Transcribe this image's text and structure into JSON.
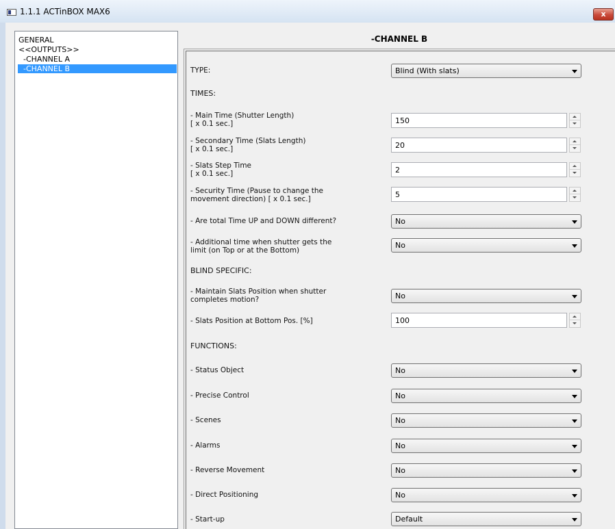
{
  "window": {
    "title": "1.1.1 ACTinBOX MAX6",
    "close_label": "x"
  },
  "tree": {
    "items": [
      "GENERAL",
      "<<OUTPUTS>>",
      "-CHANNEL A",
      "-CHANNEL B"
    ],
    "selected": "-CHANNEL B"
  },
  "page": {
    "heading": "-CHANNEL B"
  },
  "type": {
    "label": "TYPE:",
    "value": "Blind (With slats)"
  },
  "times": {
    "heading": "TIMES:",
    "main_time": {
      "label_line1": "- Main Time (Shutter Length)",
      "label_line2": "  [ x 0.1 sec.]",
      "value": "150"
    },
    "secondary_time": {
      "label_line1": "- Secondary Time (Slats Length)",
      "label_line2": "  [ x 0.1 sec.]",
      "value": "20"
    },
    "slats_step_time": {
      "label_line1": "- Slats Step Time",
      "label_line2": "  [ x 0.1 sec.]",
      "value": "2"
    },
    "security_time": {
      "label_line1": "- Security Time (Pause to change the",
      "label_line2": "  movement direction) [ x 0.1 sec.]",
      "value": "5"
    },
    "total_time_different": {
      "label": "- Are total Time UP and DOWN different?",
      "value": "No"
    },
    "additional_time": {
      "label_line1": "- Additional time when shutter gets the",
      "label_line2": "  limit (on Top or at the Bottom)",
      "value": "No"
    }
  },
  "blind_specific": {
    "heading": "BLIND SPECIFIC:",
    "maintain_slats": {
      "label_line1": "- Maintain Slats Position when shutter",
      "label_line2": "  completes motion?",
      "value": "No"
    },
    "slats_bottom": {
      "label": "- Slats Position at Bottom Pos. [%]",
      "value": "100"
    }
  },
  "functions": {
    "heading": "FUNCTIONS:",
    "items": [
      {
        "label": "- Status Object",
        "value": "No"
      },
      {
        "label": "- Precise Control",
        "value": "No"
      },
      {
        "label": "- Scenes",
        "value": "No"
      },
      {
        "label": "- Alarms",
        "value": "No"
      },
      {
        "label": "- Reverse Movement",
        "value": "No"
      },
      {
        "label": "- Direct Positioning",
        "value": "No"
      },
      {
        "label": "- Start-up",
        "value": "Default"
      }
    ]
  }
}
